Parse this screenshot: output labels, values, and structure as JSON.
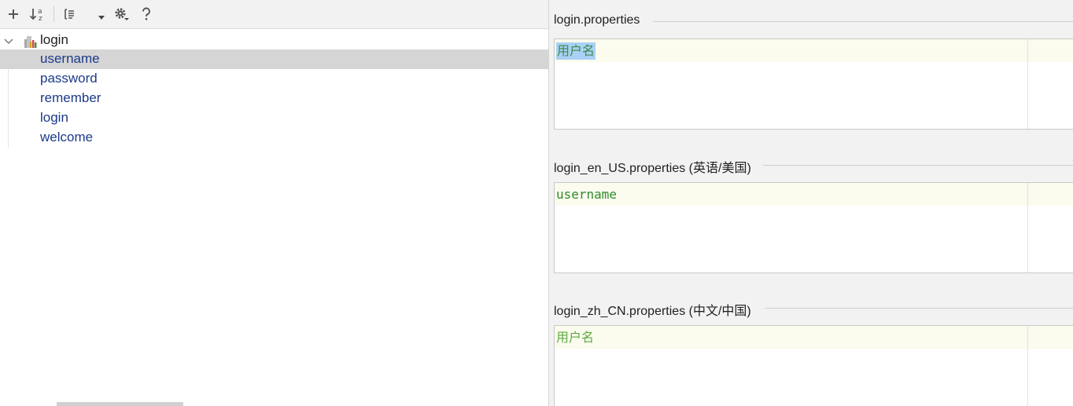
{
  "toolbar": {
    "buttons": [
      {
        "icon": "plus-icon"
      },
      {
        "icon": "sort-alpha-icon"
      },
      {
        "icon": "list-view-icon"
      },
      {
        "icon": "dropdown-arrow-icon"
      },
      {
        "icon": "gear-icon"
      },
      {
        "icon": "help-icon"
      }
    ]
  },
  "tree": {
    "root_label": "login",
    "items": [
      {
        "label": "username",
        "selected": true
      },
      {
        "label": "password",
        "selected": false
      },
      {
        "label": "remember",
        "selected": false
      },
      {
        "label": "login",
        "selected": false
      },
      {
        "label": "welcome",
        "selected": false
      }
    ]
  },
  "editors": [
    {
      "title": "login.properties",
      "value": "用户名",
      "value_style": "selected"
    },
    {
      "title": "login_en_US.properties (英语/美国)",
      "value": "username",
      "value_style": "green"
    },
    {
      "title": "login_zh_CN.properties (中文/中国)",
      "value": "用户名",
      "value_style": "lightgreen"
    }
  ],
  "colors": {
    "tree_item_text": "#1c3a8a",
    "selection_bg": "#d5d5d5",
    "current_line_bg": "#fbfbee",
    "text_highlight": "#a9d1f5",
    "value_green": "#2e8b2e"
  }
}
